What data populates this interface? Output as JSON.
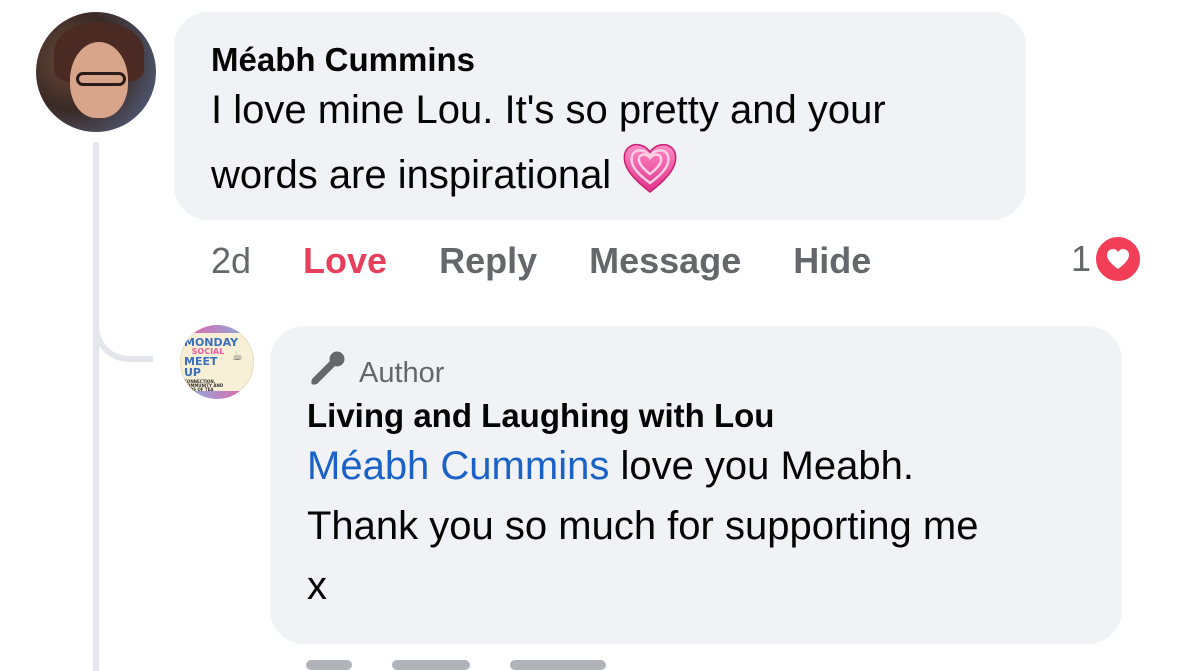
{
  "comment": {
    "author": "Méabh Cummins",
    "text_line1": "I love mine Lou. It's so pretty and your",
    "text_line2": "words are inspirational",
    "emoji": "sparkling-heart",
    "time": "2d",
    "actions": {
      "love": "Love",
      "reply": "Reply",
      "message": "Message",
      "hide": "Hide"
    },
    "reaction_count": "1",
    "colors": {
      "love_active": "#e63f5c",
      "reaction_heart": "#f33e58"
    }
  },
  "reply": {
    "badge": "Author",
    "author": "Living and Laughing with Lou",
    "mention": "Méabh Cummins",
    "text_line1": " love you Meabh.",
    "text_line2": "Thank you so much for supporting me",
    "text_line3": "x",
    "avatar_logo": {
      "line1": "MONDAY",
      "line2": "SOCIAL",
      "line3": "MEET UP",
      "line4": "CONNECTION, COMMUNITY AND CUPS OF TEA"
    },
    "colors": {
      "mention": "#1a62c8"
    }
  }
}
